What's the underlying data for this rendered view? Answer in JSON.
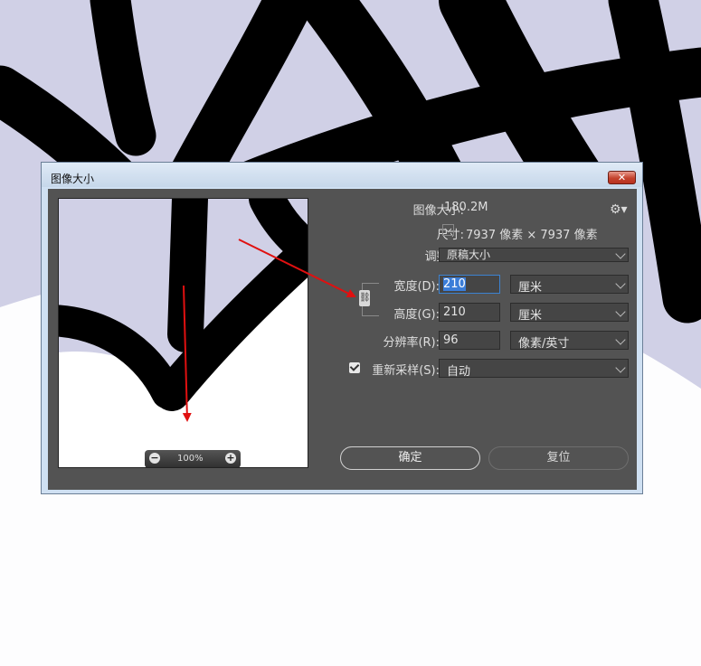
{
  "dialog": {
    "title": "图像大小",
    "close_label": "✕"
  },
  "zoom": {
    "level": "100%",
    "minus": "−",
    "plus": "+"
  },
  "info": {
    "image_size_label": "图像大小:",
    "image_size_value": "180.2M",
    "dimensions_label": "尺寸:",
    "dimensions_value": "7937 像素  ×  7937 像素",
    "fit_to_label": "调整为:",
    "fit_to_value": "原稿大小"
  },
  "width": {
    "label": "宽度(D):",
    "value": "210",
    "unit": "厘米"
  },
  "height": {
    "label": "高度(G):",
    "value": "210",
    "unit": "厘米"
  },
  "resolution": {
    "label": "分辨率(R):",
    "value": "96",
    "unit": "像素/英寸"
  },
  "resample": {
    "label": "重新采样(S):",
    "value": "自动",
    "checked": true
  },
  "buttons": {
    "ok": "确定",
    "reset": "复位"
  },
  "icons": {
    "gear": "gear-icon",
    "link": "chain-link-icon",
    "close": "close-icon"
  },
  "colors": {
    "annotation_arrow": "#e01010",
    "canvas_fill": "#d0d0e6",
    "dialog_bg": "#535353"
  }
}
